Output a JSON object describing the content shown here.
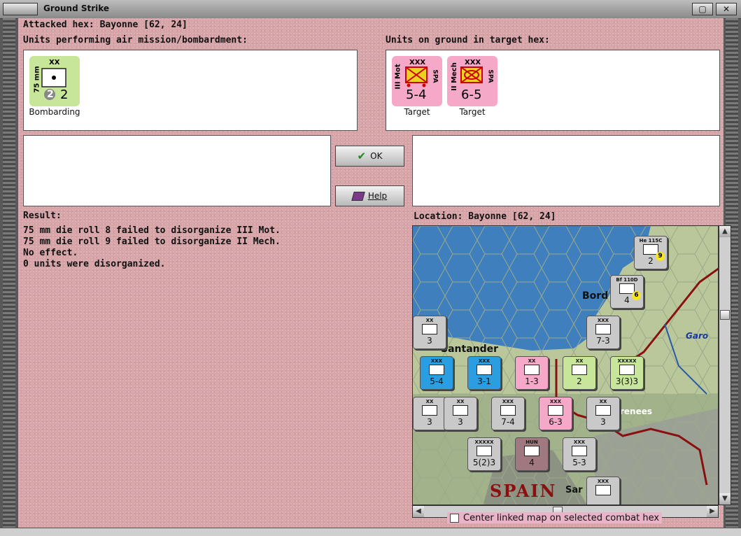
{
  "window": {
    "title": "Ground Strike",
    "close_glyph": "✕",
    "max_glyph": "▢"
  },
  "attacked_hex": "Attacked hex: Bayonne  [62, 24]",
  "air_units_label": "Units performing air mission/bombardment:",
  "ground_units_label": "Units on ground in target hex:",
  "air_units": [
    {
      "side": "75 mm",
      "size": "XX",
      "badge": "2",
      "strength": "2",
      "caption": "Bombarding",
      "color": "#c8e69a"
    }
  ],
  "ground_units": [
    {
      "side": "III Mot",
      "nation": "SPA",
      "size": "XXX",
      "strength": "5-4",
      "caption": "Target",
      "color": "#f5a8c8"
    },
    {
      "side": "II Mech",
      "nation": "SPA",
      "size": "XXX",
      "strength": "6-5",
      "caption": "Target",
      "color": "#f5a8c8"
    }
  ],
  "buttons": {
    "ok": "OK",
    "help": "Help"
  },
  "result_label": "Result:",
  "result_lines": [
    "75 mm die roll 8 failed to disorganize III Mot.",
    "75 mm die roll 9 failed to disorganize II Mech.",
    "No effect.",
    "0 units were disorganized."
  ],
  "location_label": "Location:  Bayonne  [62, 24]",
  "map": {
    "labels": {
      "bordeaux": "Bord",
      "santander": "Santander",
      "pyrenees": "renees",
      "spain": "SPAIN",
      "garonne": "Garo",
      "sar": "Sar"
    },
    "units": [
      {
        "top": "He 115C",
        "val": "2",
        "sub": "9",
        "color": "#c9c9c9"
      },
      {
        "top": "Bf 110D",
        "val": "4",
        "sub": "6",
        "color": "#c9c9c9"
      },
      {
        "top": "XXX",
        "val": "7-3",
        "color": "#c9c9c9"
      },
      {
        "top": "XX",
        "val": "3",
        "color": "#c9c9c9"
      },
      {
        "top": "XXX",
        "val": "5-4",
        "color": "#2a9ee0"
      },
      {
        "top": "XXX",
        "val": "3-1",
        "color": "#2a9ee0"
      },
      {
        "top": "XX",
        "val": "1-3",
        "color": "#f5a8c8"
      },
      {
        "top": "XX",
        "val": "2",
        "color": "#c8e69a"
      },
      {
        "top": "XXXXX",
        "val": "3(3)3",
        "color": "#c8e69a"
      },
      {
        "top": "XX",
        "val": "3",
        "color": "#c9c9c9"
      },
      {
        "top": "XX",
        "val": "3",
        "color": "#c9c9c9"
      },
      {
        "top": "XXX",
        "val": "7-4",
        "color": "#c9c9c9"
      },
      {
        "top": "XXX",
        "val": "6-3",
        "color": "#f5a8c8"
      },
      {
        "top": "XX",
        "val": "3",
        "color": "#c9c9c9"
      },
      {
        "top": "XXXXX",
        "val": "5(2)3",
        "color": "#c9c9c9"
      },
      {
        "top": "HUN",
        "val": "4",
        "color": "#a07880"
      },
      {
        "top": "XXX",
        "val": "5-3",
        "color": "#c9c9c9"
      },
      {
        "top": "XXX",
        "val": "",
        "color": "#c9c9c9"
      }
    ]
  },
  "checkbox": {
    "label": "Center linked map on selected combat hex",
    "checked": false
  }
}
